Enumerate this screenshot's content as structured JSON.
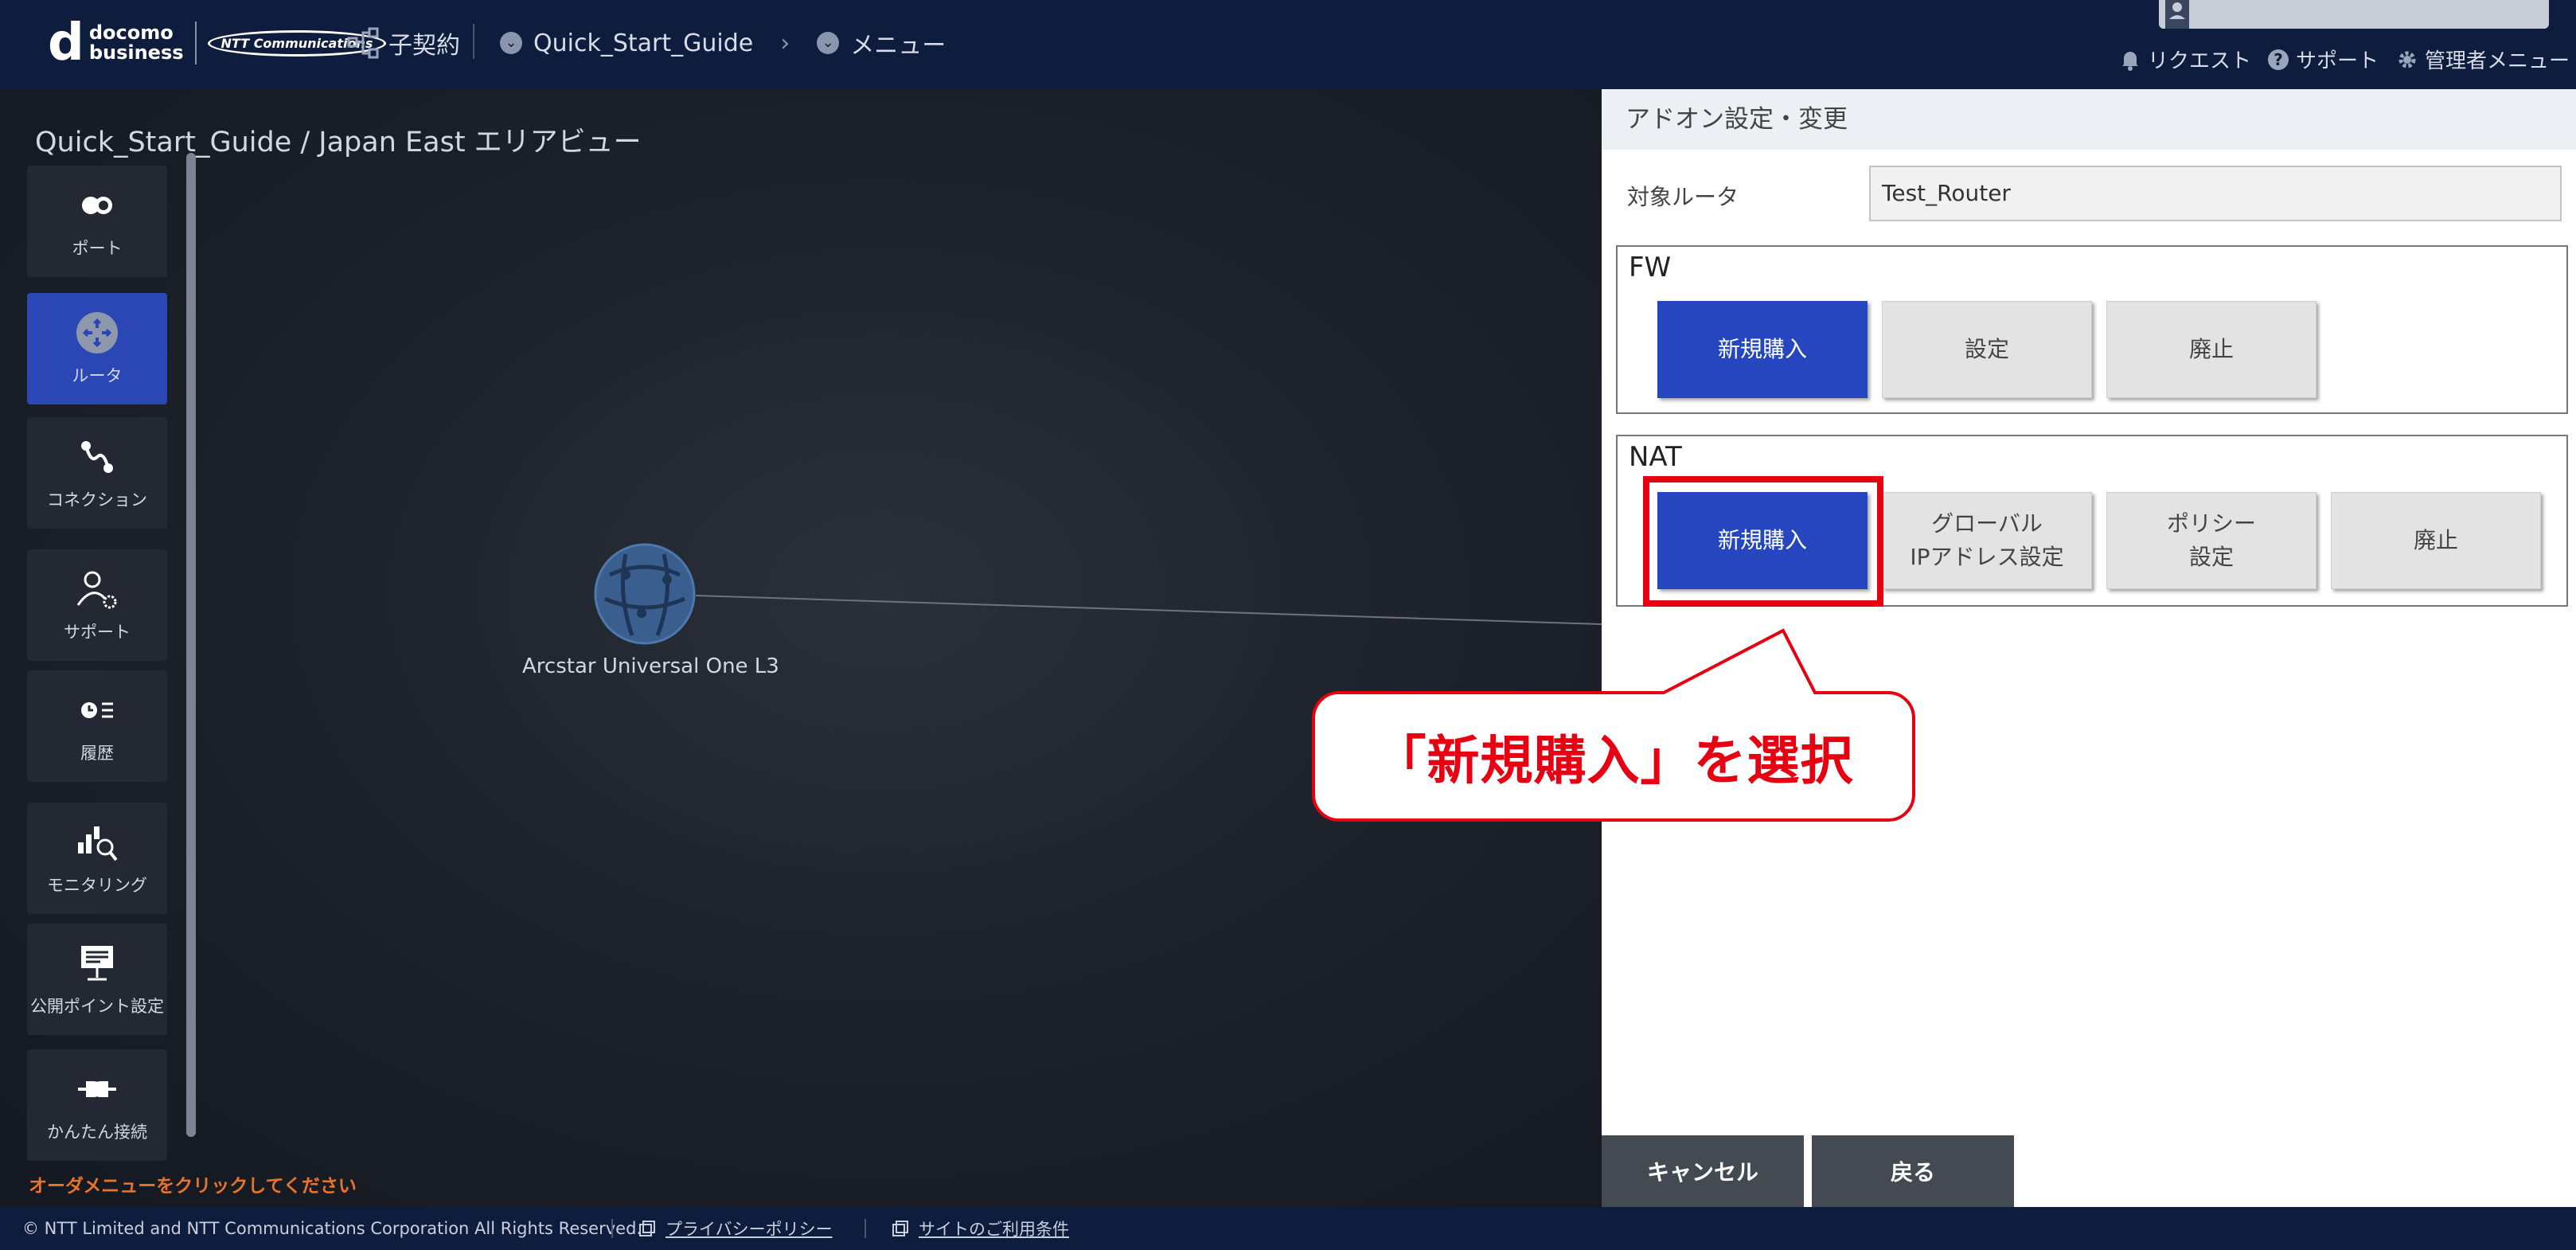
{
  "header": {
    "logo_mark": "d",
    "logo_line1": "docomo",
    "logo_line2": "business",
    "logo_ntt": "NTT Communications",
    "contract_label": "子契約",
    "breadcrumb": [
      "Quick_Start_Guide",
      "メニュー"
    ],
    "utility": [
      "リクエスト",
      "サポート",
      "管理者メニュー"
    ]
  },
  "canvas": {
    "title": "Quick_Start_Guide / Japan East エリアビュー",
    "node_label": "Arcstar Universal One L3",
    "order_hint": "オーダメニューをクリックしてください"
  },
  "sidebar": {
    "items": [
      {
        "label": "ポート",
        "icon": "port-icon",
        "active": false
      },
      {
        "label": "ルータ",
        "icon": "router-icon",
        "active": true
      },
      {
        "label": "コネクション",
        "icon": "connection-icon",
        "active": false
      },
      {
        "label": "サポート",
        "icon": "support-icon",
        "active": false
      },
      {
        "label": "履歴",
        "icon": "history-icon",
        "active": false
      },
      {
        "label": "モニタリング",
        "icon": "monitoring-icon",
        "active": false
      },
      {
        "label": "公開ポイント設定",
        "icon": "public-point-icon",
        "active": false
      },
      {
        "label": "かんたん接続",
        "icon": "easy-connect-icon",
        "active": false
      }
    ]
  },
  "panel": {
    "title": "アドオン設定・変更",
    "target_label": "対象ルータ",
    "target_value": "Test_Router",
    "fw": {
      "title": "FW",
      "buttons": [
        "新規購入",
        "設定",
        "廃止"
      ]
    },
    "nat": {
      "title": "NAT",
      "buttons": [
        "新規購入",
        "グローバル",
        "IPアドレス設定",
        "ポリシー",
        "設定",
        "廃止"
      ]
    },
    "cancel": "キャンセル",
    "back": "戻る"
  },
  "callout": {
    "text": "「新規購入」を選択",
    "color": "#e60012"
  },
  "footer": {
    "copyright": "© NTT Limited and NTT Communications Corporation All Rights Reserved.",
    "privacy": "プライバシーポリシー",
    "terms": "サイトのご利用条件"
  },
  "colors": {
    "header_bg": "#0e1d3d",
    "primary_button": "#2646bf",
    "active_sidebar": "#2a47b5",
    "highlight": "#e60012",
    "hint": "#e7742b"
  }
}
